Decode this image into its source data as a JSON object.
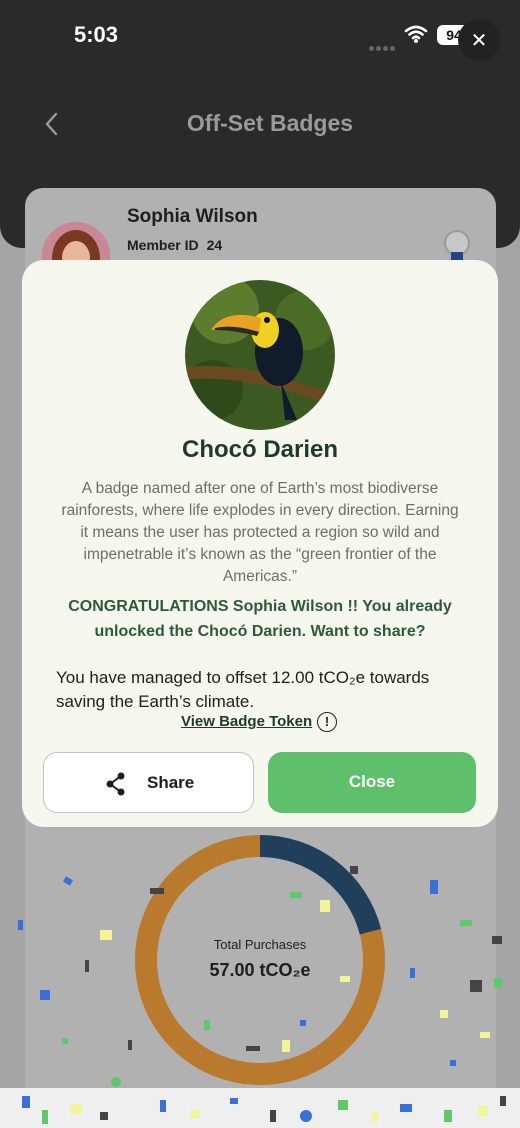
{
  "status_bar": {
    "time": "5:03",
    "battery": "94"
  },
  "header": {
    "title": "Off-Set Badges",
    "back_icon": "chevron-left-icon"
  },
  "overlay_close_icon": "close-icon",
  "profile": {
    "name": "Sophia Wilson",
    "member_id_label": "Member ID",
    "member_id": "24"
  },
  "badge_modal": {
    "title": "Chocó Darien",
    "description": "A badge named after one of Earth’s most biodiverse rainforests, where life explodes in every direction. Earning it means the user has protected a region so wild and impenetrable it’s known as the “green frontier of the Americas.”",
    "congrats": "CONGRATULATIONS Sophia Wilson !! You already unlocked the Chocó Darien. Want to share?",
    "offset_text": "You have managed to offset 12.00 tCO₂e towards saving the Earth’s climate.",
    "view_token_label": "View Badge Token",
    "share_label": "Share",
    "close_label": "Close"
  },
  "donut": {
    "label": "Total Purchases",
    "value": "57.00 tCO₂e",
    "segments": [
      {
        "share": 0.21,
        "color": "#1f3f5b"
      },
      {
        "share": 0.79,
        "color": "#b97a2e"
      }
    ]
  },
  "colors": {
    "accent_green": "#5fc06b",
    "dark_green_text": "#1f3a2d"
  }
}
